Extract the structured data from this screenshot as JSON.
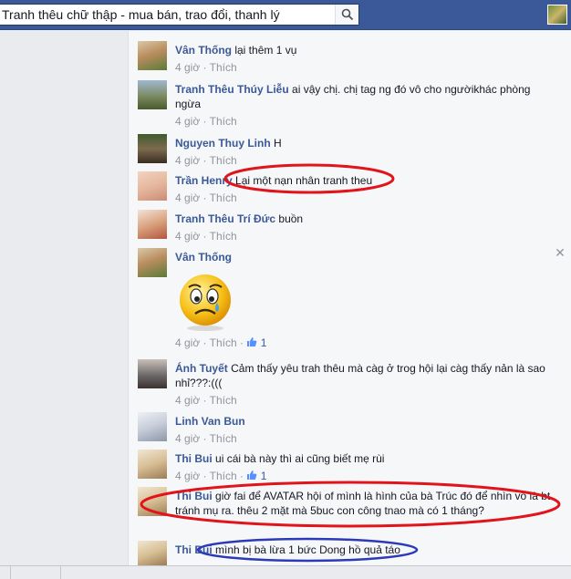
{
  "search": {
    "value": "Tranh thêu chữ thập - mua bán, trao đổi, thanh lý"
  },
  "icons": {
    "search": "search-icon",
    "like": "thumbs-up-icon",
    "close": "close-icon"
  },
  "colors": {
    "topbar": "#3b5998",
    "name": "#3b5998",
    "meta": "#90949c",
    "red_ellipse": "#e2141b",
    "blue_ellipse": "#2b3bb8"
  },
  "comments": [
    {
      "name": "Vân Thống",
      "text": "lại thêm 1 vụ",
      "time": "4 giờ",
      "like": "Thích"
    },
    {
      "name": "Tranh Thêu Thúy Liễu",
      "text": "ai vậy chị. chị tag ng đó vô cho ngườikhác phòng ngừa",
      "time": "4 giờ",
      "like": "Thích"
    },
    {
      "name": "Nguyen Thuy Linh",
      "text": "H",
      "time": "4 giờ",
      "like": "Thích"
    },
    {
      "name": "Trần Henry",
      "text": "Lại một nạn nhân tranh theu",
      "time": "4 giờ",
      "like": "Thích"
    },
    {
      "name": "Tranh Thêu Trí Đức",
      "text": "buồn",
      "time": "4 giờ",
      "like": "Thích"
    },
    {
      "name": "Vân Thống",
      "text": "",
      "time": "4 giờ",
      "like": "Thích",
      "like_count": "1"
    },
    {
      "name": "Ánh Tuyết",
      "text": "Cảm thấy yêu trah thêu mà càg ở trog hội lại càg thấy nản là sao nhỉ???:(((",
      "time": "4 giờ",
      "like": "Thích"
    },
    {
      "name": "Linh Van Bun",
      "text": "",
      "time": "4 giờ",
      "like": "Thích"
    },
    {
      "name": "Thi Bui",
      "text": "ui cái bà này thì ai cũng biết mẹ rùi",
      "time": "4 giờ",
      "like": "Thích",
      "like_count": "1"
    },
    {
      "name": "Thi Bui",
      "text": "giờ fai để AVATAR hội of mình là hình của bà Trúc đó để nhìn vô là bt tránh mụ ra. thêu 2 mặt mà 5buc con công tnao mà có 1 tháng?",
      "time": "",
      "like": ""
    },
    {
      "name": "Thi Bui",
      "text": "mình bị bà lừa 1 bức Dong hồ quả táo",
      "time": "",
      "like": ""
    }
  ]
}
